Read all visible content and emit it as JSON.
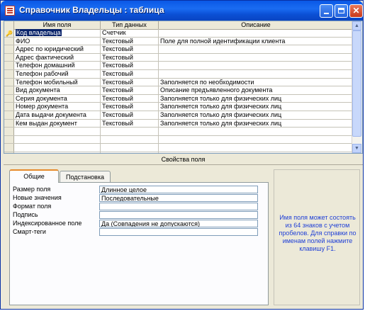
{
  "window": {
    "title": "Справочник Владельцы : таблица"
  },
  "grid": {
    "headers": [
      "Имя поля",
      "Тип данных",
      "Описание"
    ],
    "rows": [
      {
        "name": "Код владельца",
        "type": "Счетчик",
        "desc": ""
      },
      {
        "name": "ФИО",
        "type": "Текстовый",
        "desc": "Поле для полной идентификации клиента"
      },
      {
        "name": "Адрес по юридический",
        "type": "Текстовый",
        "desc": ""
      },
      {
        "name": "Адрес фактический",
        "type": "Текстовый",
        "desc": ""
      },
      {
        "name": "Телефон домашний",
        "type": "Текстовый",
        "desc": ""
      },
      {
        "name": "Телефон рабочий",
        "type": "Текстовый",
        "desc": ""
      },
      {
        "name": "Телефон мобильный",
        "type": "Текстовый",
        "desc": "Заполняется по необходимости"
      },
      {
        "name": "Вид документа",
        "type": "Текстовый",
        "desc": "Описание предъявленного документа"
      },
      {
        "name": "Серия документа",
        "type": "Текстовый",
        "desc": "Заполняется только для физических лиц"
      },
      {
        "name": "Номер документа",
        "type": "Текстовый",
        "desc": "Заполняется только для физических лиц"
      },
      {
        "name": "Дата выдачи документа",
        "type": "Текстовый",
        "desc": "Заполняется только для физических лиц"
      },
      {
        "name": "Кем выдан документ",
        "type": "Текстовый",
        "desc": "Заполняется только для физических лиц"
      },
      {
        "name": "",
        "type": "",
        "desc": ""
      },
      {
        "name": "",
        "type": "",
        "desc": ""
      },
      {
        "name": "",
        "type": "",
        "desc": ""
      },
      {
        "name": "",
        "type": "",
        "desc": ""
      }
    ]
  },
  "properties": {
    "section_label": "Свойства поля",
    "tabs": [
      "Общие",
      "Подстановка"
    ],
    "rows": [
      {
        "label": "Размер поля",
        "value": "Длинное целое"
      },
      {
        "label": "Новые значения",
        "value": "Последовательные"
      },
      {
        "label": "Формат поля",
        "value": ""
      },
      {
        "label": "Подпись",
        "value": ""
      },
      {
        "label": "Индексированное поле",
        "value": "Да (Совпадения не допускаются)"
      },
      {
        "label": "Смарт-теги",
        "value": ""
      }
    ],
    "help_text": "Имя поля может состоять из 64 знаков с учетом пробелов.  Для справки по именам полей нажмите клавишу F1."
  },
  "icons": {
    "app": "table-icon",
    "key": "primary-key-icon",
    "minimize": "minimize-icon",
    "maximize": "maximize-icon",
    "close": "close-icon"
  },
  "colors": {
    "titlebar": "#0a58e6",
    "help_text": "#1f3fd6",
    "selection": "#0a246a"
  }
}
